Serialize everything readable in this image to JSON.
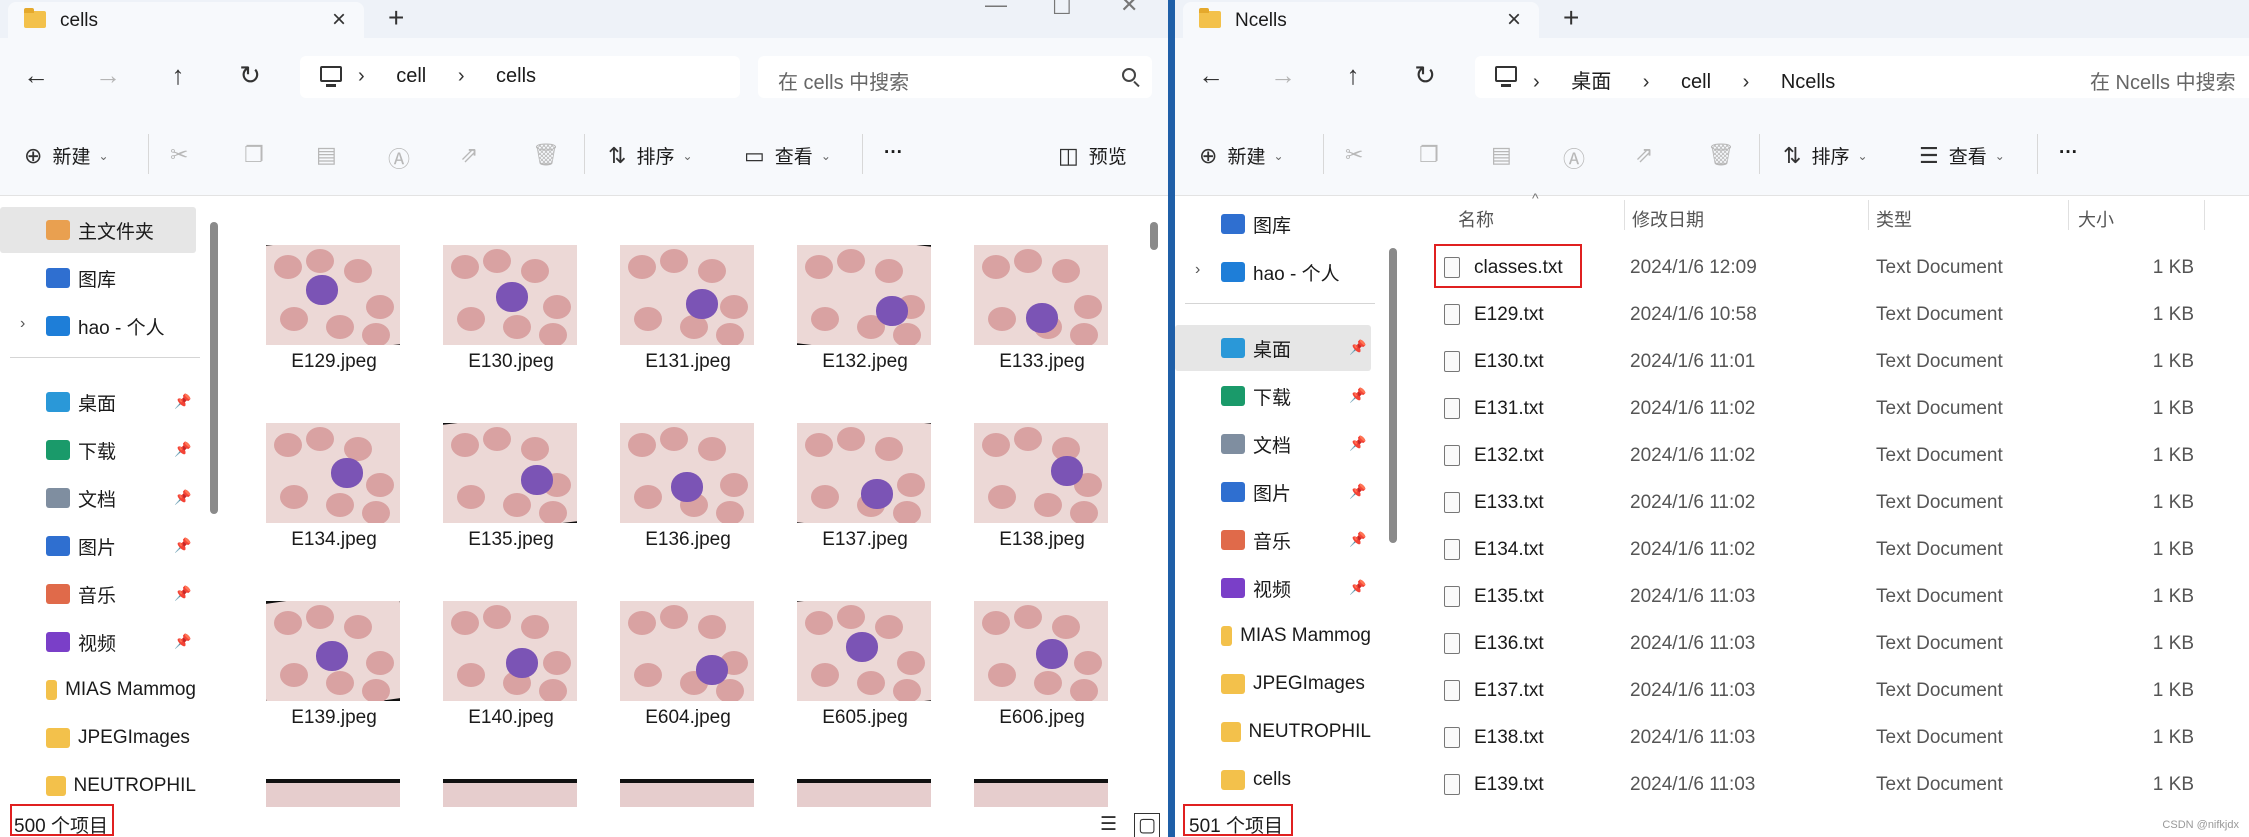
{
  "left": {
    "tab_title": "cells",
    "breadcrumb": [
      "cell",
      "cells"
    ],
    "search_placeholder": "在 cells 中搜索",
    "toolbar": {
      "new": "新建",
      "sort": "排序",
      "view": "查看",
      "more": "···",
      "preview": "预览"
    },
    "sidebar": [
      {
        "label": "主文件夹",
        "icon": "home-icon",
        "color": "#e9a050",
        "selected": true
      },
      {
        "label": "图库",
        "icon": "gallery-icon",
        "color": "#2f6fd0"
      },
      {
        "label": "hao - 个人",
        "icon": "cloud-icon",
        "color": "#1e7ed8",
        "expandable": true
      },
      {
        "label": "桌面",
        "icon": "desktop-icon",
        "color": "#2a98d8",
        "pinned": true
      },
      {
        "label": "下载",
        "icon": "download-icon",
        "color": "#1a9a6a",
        "pinned": true
      },
      {
        "label": "文档",
        "icon": "document-icon",
        "color": "#7f8ea0",
        "pinned": true
      },
      {
        "label": "图片",
        "icon": "pictures-icon",
        "color": "#2f6fd0",
        "pinned": true
      },
      {
        "label": "音乐",
        "icon": "music-icon",
        "color": "#e06a4a",
        "pinned": true
      },
      {
        "label": "视频",
        "icon": "video-icon",
        "color": "#7a3fc8",
        "pinned": true
      },
      {
        "label": "MIAS Mammog",
        "icon": "folder-icon",
        "color": "#f3c14b"
      },
      {
        "label": "JPEGImages",
        "icon": "folder-icon",
        "color": "#f3c14b"
      },
      {
        "label": "NEUTROPHIL",
        "icon": "folder-icon",
        "color": "#f3c14b"
      }
    ],
    "files": [
      "E129.jpeg",
      "E130.jpeg",
      "E131.jpeg",
      "E132.jpeg",
      "E133.jpeg",
      "E134.jpeg",
      "E135.jpeg",
      "E136.jpeg",
      "E137.jpeg",
      "E138.jpeg",
      "E139.jpeg",
      "E140.jpeg",
      "E604.jpeg",
      "E605.jpeg",
      "E606.jpeg"
    ],
    "status": "500 个项目"
  },
  "right": {
    "tab_title": "Ncells",
    "breadcrumb": [
      "桌面",
      "cell",
      "Ncells"
    ],
    "search_placeholder": "在 Ncells 中搜索",
    "toolbar": {
      "new": "新建",
      "sort": "排序",
      "view": "查看",
      "more": "···"
    },
    "sidebar": [
      {
        "label": "图库",
        "icon": "gallery-icon",
        "color": "#2f6fd0"
      },
      {
        "label": "hao - 个人",
        "icon": "cloud-icon",
        "color": "#1e7ed8",
        "expandable": true
      },
      {
        "label": "桌面",
        "icon": "desktop-icon",
        "color": "#2a98d8",
        "pinned": true,
        "selected": true
      },
      {
        "label": "下载",
        "icon": "download-icon",
        "color": "#1a9a6a",
        "pinned": true
      },
      {
        "label": "文档",
        "icon": "document-icon",
        "color": "#7f8ea0",
        "pinned": true
      },
      {
        "label": "图片",
        "icon": "pictures-icon",
        "color": "#2f6fd0",
        "pinned": true
      },
      {
        "label": "音乐",
        "icon": "music-icon",
        "color": "#e06a4a",
        "pinned": true
      },
      {
        "label": "视频",
        "icon": "video-icon",
        "color": "#7a3fc8",
        "pinned": true
      },
      {
        "label": "MIAS Mammog",
        "icon": "folder-icon",
        "color": "#f3c14b"
      },
      {
        "label": "JPEGImages",
        "icon": "folder-icon",
        "color": "#f3c14b"
      },
      {
        "label": "NEUTROPHIL",
        "icon": "folder-icon",
        "color": "#f3c14b"
      },
      {
        "label": "cells",
        "icon": "folder-icon",
        "color": "#f3c14b"
      }
    ],
    "columns": {
      "name": "名称",
      "date": "修改日期",
      "type": "类型",
      "size": "大小"
    },
    "files": [
      {
        "name": "classes.txt",
        "date": "2024/1/6 12:09",
        "type": "Text Document",
        "size": "1 KB",
        "highlight": true
      },
      {
        "name": "E129.txt",
        "date": "2024/1/6 10:58",
        "type": "Text Document",
        "size": "1 KB"
      },
      {
        "name": "E130.txt",
        "date": "2024/1/6 11:01",
        "type": "Text Document",
        "size": "1 KB"
      },
      {
        "name": "E131.txt",
        "date": "2024/1/6 11:02",
        "type": "Text Document",
        "size": "1 KB"
      },
      {
        "name": "E132.txt",
        "date": "2024/1/6 11:02",
        "type": "Text Document",
        "size": "1 KB"
      },
      {
        "name": "E133.txt",
        "date": "2024/1/6 11:02",
        "type": "Text Document",
        "size": "1 KB"
      },
      {
        "name": "E134.txt",
        "date": "2024/1/6 11:02",
        "type": "Text Document",
        "size": "1 KB"
      },
      {
        "name": "E135.txt",
        "date": "2024/1/6 11:03",
        "type": "Text Document",
        "size": "1 KB"
      },
      {
        "name": "E136.txt",
        "date": "2024/1/6 11:03",
        "type": "Text Document",
        "size": "1 KB"
      },
      {
        "name": "E137.txt",
        "date": "2024/1/6 11:03",
        "type": "Text Document",
        "size": "1 KB"
      },
      {
        "name": "E138.txt",
        "date": "2024/1/6 11:03",
        "type": "Text Document",
        "size": "1 KB"
      },
      {
        "name": "E139.txt",
        "date": "2024/1/6 11:03",
        "type": "Text Document",
        "size": "1 KB"
      }
    ],
    "status": "501 个项目"
  },
  "watermark": "CSDN @nifkjdx"
}
